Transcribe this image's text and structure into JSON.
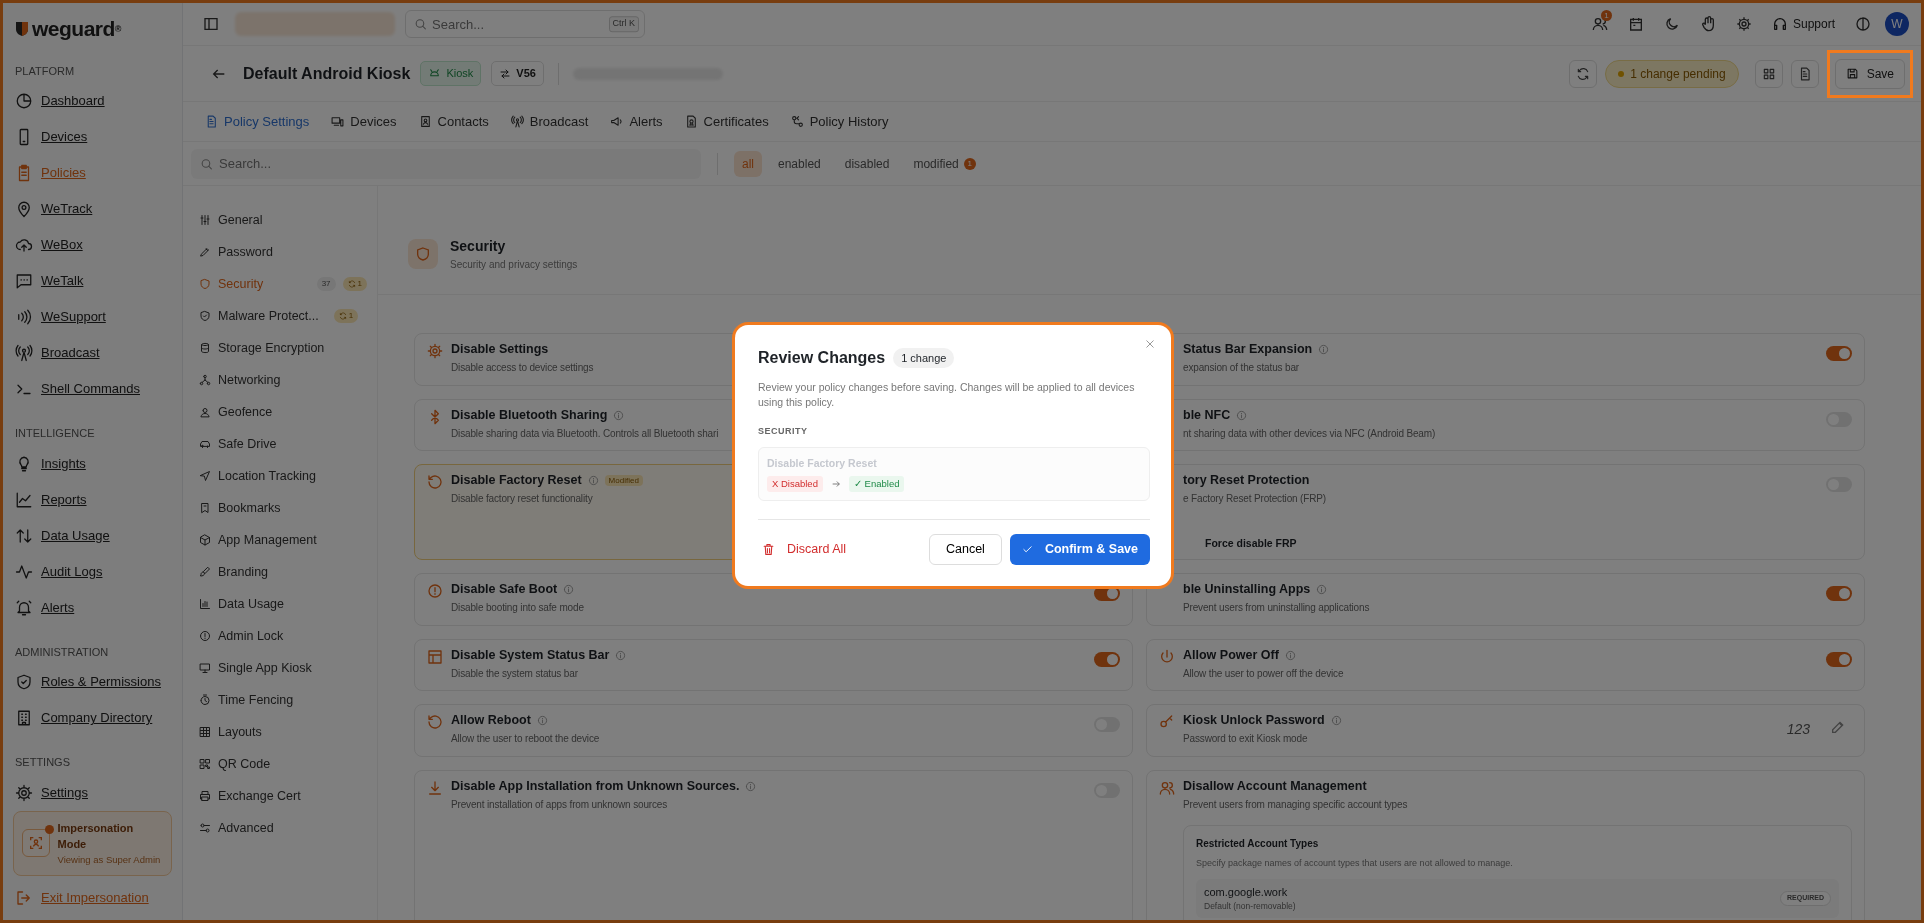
{
  "brand": {
    "logo": "weguard$^{®}$"
  },
  "topbar": {
    "search_placeholder": "Search...",
    "shortcut": "Ctrl K",
    "notification_count": "1",
    "support": "Support",
    "avatar": "W"
  },
  "header": {
    "title": "Default Android Kiosk",
    "platform_badge": "Kiosk",
    "version_badge": "V56",
    "pending": "1 change pending",
    "save": "Save"
  },
  "tabs": [
    {
      "label": "Policy Settings",
      "selected": true
    },
    {
      "label": "Devices",
      "selected": false
    },
    {
      "label": "Contacts",
      "selected": false
    },
    {
      "label": "Broadcast",
      "selected": false
    },
    {
      "label": "Alerts",
      "selected": false
    },
    {
      "label": "Certificates",
      "selected": false
    },
    {
      "label": "Policy History",
      "selected": false
    }
  ],
  "filter": {
    "placeholder": "Search...",
    "options": [
      {
        "label": "all",
        "selected": true
      },
      {
        "label": "enabled",
        "selected": false
      },
      {
        "label": "disabled",
        "selected": false
      },
      {
        "label": "modified",
        "selected": false,
        "count": "1"
      }
    ]
  },
  "sidebar": {
    "sections": [
      {
        "heading": "PLATFORM",
        "items": [
          {
            "label": "Dashboard",
            "selected": false
          },
          {
            "label": "Devices",
            "selected": false
          },
          {
            "label": "Policies",
            "selected": true
          },
          {
            "label": "WeTrack",
            "selected": false
          },
          {
            "label": "WeBox",
            "selected": false
          },
          {
            "label": "WeTalk",
            "selected": false
          },
          {
            "label": "WeSupport",
            "selected": false
          },
          {
            "label": "Broadcast",
            "selected": false
          },
          {
            "label": "Shell Commands",
            "selected": false
          }
        ]
      },
      {
        "heading": "INTELLIGENCE",
        "items": [
          {
            "label": "Insights",
            "selected": false
          },
          {
            "label": "Reports",
            "selected": false
          },
          {
            "label": "Data Usage",
            "selected": false
          },
          {
            "label": "Audit Logs",
            "selected": false
          },
          {
            "label": "Alerts",
            "selected": false
          }
        ]
      },
      {
        "heading": "ADMINISTRATION",
        "items": [
          {
            "label": "Roles & Permissions",
            "selected": false
          },
          {
            "label": "Company Directory",
            "selected": false
          }
        ]
      },
      {
        "heading": "SETTINGS",
        "items": [
          {
            "label": "Settings",
            "selected": false
          }
        ]
      }
    ],
    "impersonation": {
      "title": "Impersonation Mode",
      "subtitle": "Viewing as Super Admin"
    },
    "exit": "Exit Impersonation"
  },
  "settings_nav": [
    {
      "label": "General",
      "selected": false
    },
    {
      "label": "Password",
      "selected": false
    },
    {
      "label": "Security",
      "selected": true,
      "count": "37",
      "changes": "1"
    },
    {
      "label": "Malware Protect...",
      "selected": false,
      "changes": "1"
    },
    {
      "label": "Storage Encryption",
      "selected": false
    },
    {
      "label": "Networking",
      "selected": false
    },
    {
      "label": "Geofence",
      "selected": false
    },
    {
      "label": "Safe Drive",
      "selected": false
    },
    {
      "label": "Location Tracking",
      "selected": false
    },
    {
      "label": "Bookmarks",
      "selected": false
    },
    {
      "label": "App Management",
      "selected": false
    },
    {
      "label": "Branding",
      "selected": false
    },
    {
      "label": "Data Usage",
      "selected": false
    },
    {
      "label": "Admin Lock",
      "selected": false
    },
    {
      "label": "Single App Kiosk",
      "selected": false
    },
    {
      "label": "Time Fencing",
      "selected": false
    },
    {
      "label": "Layouts",
      "selected": false
    },
    {
      "label": "QR Code",
      "selected": false
    },
    {
      "label": "Exchange Cert",
      "selected": false
    },
    {
      "label": "Advanced",
      "selected": false
    }
  ],
  "section": {
    "title": "Security",
    "subtitle": "Security and privacy settings"
  },
  "policies_left": [
    {
      "kind": "plain",
      "title": "Disable Settings",
      "description": "Disable access to device settings",
      "info": false
    },
    {
      "kind": "plain",
      "title": "Disable Bluetooth Sharing",
      "description": "Disable sharing data via Bluetooth. Controls all Bluetooth shari",
      "info": true
    },
    {
      "kind": "plain",
      "title": "Disable Factory Reset",
      "description": "Disable factory reset functionality",
      "info": true,
      "modified": true,
      "badge": "Modified"
    },
    {
      "kind": "toggle",
      "title": "Disable Safe Boot",
      "description": "Disable booting into safe mode",
      "info": true,
      "on": true
    },
    {
      "kind": "toggle",
      "title": "Disable System Status Bar",
      "description": "Disable the system status bar",
      "info": true,
      "on": true
    },
    {
      "kind": "toggle",
      "title": "Allow Reboot",
      "description": "Allow the user to reboot the device",
      "info": true,
      "on": false
    },
    {
      "kind": "toggle",
      "title": "Disable App Installation from Unknown Sources.",
      "description": "Prevent installation of apps from unknown sources",
      "info": true,
      "on": false
    }
  ],
  "policies_right": [
    {
      "kind": "toggle",
      "title": "Status Bar Expansion",
      "description": "expansion of the status bar",
      "info": true,
      "on": true
    },
    {
      "kind": "toggle",
      "title": "ble NFC",
      "description": "nt sharing data with other devices via NFC (Android Beam)",
      "info": true,
      "on": false
    },
    {
      "kind": "toggle",
      "title": "tory Reset Protection",
      "description": "e Factory Reset Protection (FRP)",
      "info": false,
      "on": false,
      "option": "Force disable FRP"
    },
    {
      "kind": "toggle",
      "title": "ble Uninstalling Apps",
      "description": "Prevent users from uninstalling applications",
      "info": true,
      "on": true
    },
    {
      "kind": "toggle",
      "title": "Allow Power Off",
      "description": "Allow the user to power off the device",
      "info": true,
      "on": true
    },
    {
      "kind": "value",
      "title": "Kiosk Unlock Password",
      "description": "Password to exit Kiosk mode",
      "info": true,
      "value": "123"
    },
    {
      "kind": "list",
      "title": "Disallow Account Management",
      "description": "Prevent users from managing specific account types",
      "info": false,
      "panel": {
        "title": "Restricted Account Types",
        "description": "Specify package names of account types that users are not allowed to manage.",
        "entries": [
          {
            "name": "com.google.work",
            "note": "Default (non-removable)",
            "tag": "REQUIRED"
          }
        ]
      }
    }
  ],
  "modal": {
    "title": "Review Changes",
    "count": "1 change",
    "description": "Review your policy changes before saving. Changes will be applied to all devices using this policy.",
    "group": "SECURITY",
    "changes": [
      {
        "name": "Disable Factory Reset",
        "from_mark": "X",
        "from": "Disabled",
        "to_mark": "✓",
        "to": "Enabled"
      }
    ],
    "discard": "Discard All",
    "cancel": "Cancel",
    "confirm": "Confirm & Save"
  }
}
